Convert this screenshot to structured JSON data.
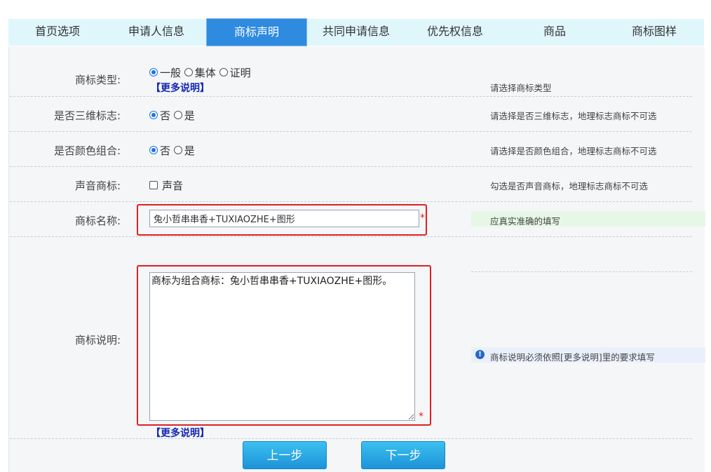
{
  "tabs": [
    {
      "label": "首页选项"
    },
    {
      "label": "申请人信息"
    },
    {
      "label": "商标声明"
    },
    {
      "label": "共同申请信息"
    },
    {
      "label": "优先权信息"
    },
    {
      "label": "商品"
    },
    {
      "label": "商标图样"
    }
  ],
  "active_tab": "商标声明",
  "form": {
    "type": {
      "label": "商标类型:",
      "options": [
        "一般",
        "集体",
        "证明"
      ],
      "selected": "一般",
      "more_link": "【更多说明】",
      "hint": "请选择商标类型"
    },
    "three_d": {
      "label": "是否三维标志:",
      "options": [
        "否",
        "是"
      ],
      "selected": "否",
      "hint": "请选择是否三维标志，地理标志商标不可选"
    },
    "color": {
      "label": "是否颜色组合:",
      "options": [
        "否",
        "是"
      ],
      "selected": "否",
      "hint": "请选择是否颜色组合，地理标志商标不可选"
    },
    "sound": {
      "label": "声音商标:",
      "checkbox_label": "声音",
      "checked": false,
      "hint": "勾选是否声音商标，地理标志商标不可选"
    },
    "name": {
      "label": "商标名称:",
      "value": "兔小哲串串香+TUXIAOZHE+图形",
      "required_mark": "*",
      "hint": "应真实准确的填写"
    },
    "description": {
      "label": "商标说明:",
      "value": "商标为组合商标：兔小哲串串香+TUXIAOZHE+图形。",
      "required_mark": "*",
      "more_link": "【更多说明】",
      "hint": "商标说明必须依照[更多说明]里的要求填写",
      "hint_icon": "info-icon"
    }
  },
  "buttons": {
    "prev": "上一步",
    "next": "下一步"
  },
  "colors": {
    "active_tab": "#2f8be0",
    "tab_bar": "#dff6fb",
    "highlight_box": "#e02020",
    "button": "#1c93d8",
    "link": "#1428b4"
  }
}
